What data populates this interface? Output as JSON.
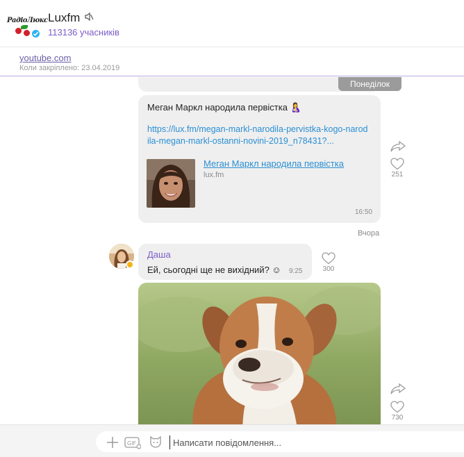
{
  "header": {
    "logo_text": "РадіоЛюкс",
    "title": "Luxfm",
    "mute_icon": "speaker-muted-icon",
    "subtitle": "113136 учасників"
  },
  "pinned": {
    "link": "youtube.com",
    "date": "Коли закріплено: 23.04.2019"
  },
  "chat": {
    "day_label": "Понеділок",
    "message1": {
      "text": "Меган Маркл народила первістка 🤱",
      "url": "https://lux.fm/megan-markl-narodila-pervistka-kogo-narodila-megan-markl-ostanni-novini-2019_n78431?...",
      "preview_title": "Меган Маркл народила первістка",
      "preview_domain": "lux.fm",
      "time": "16:50",
      "likes": "251"
    },
    "separator": "Вчора",
    "message2": {
      "author": "Даша",
      "text": "Ей, сьогодні ще не вихідний? ☺",
      "time": "9:25",
      "likes": "300"
    },
    "photo_message": {
      "likes": "730"
    }
  },
  "composer": {
    "placeholder": "Написати повідомлення..."
  },
  "colors": {
    "accent": "#7b5cc7",
    "link": "#2a8fd4",
    "bubble": "#efefef",
    "verified": "#2bb3f3"
  }
}
